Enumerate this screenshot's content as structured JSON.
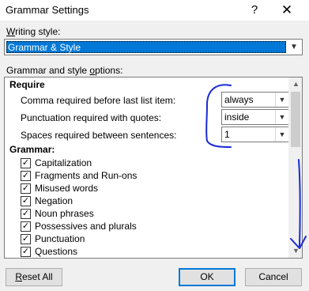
{
  "window": {
    "title": "Grammar Settings",
    "help_glyph": "?",
    "close_glyph": "✕"
  },
  "writing_style": {
    "label_hot": "W",
    "label_rest": "riting style:",
    "selected": "Grammar & Style"
  },
  "options": {
    "label_pre": "Grammar and style ",
    "label_hot": "o",
    "label_rest": "ptions:",
    "require_heading": "Require",
    "require_items": [
      {
        "label": "Comma required before last list item:",
        "value": "always"
      },
      {
        "label": "Punctuation required with quotes:",
        "value": "inside"
      },
      {
        "label": "Spaces required between sentences:",
        "value": "1"
      }
    ],
    "grammar_heading": "Grammar:",
    "grammar_items": [
      {
        "label": "Capitalization",
        "checked": true
      },
      {
        "label": "Fragments and Run-ons",
        "checked": true
      },
      {
        "label": "Misused words",
        "checked": true
      },
      {
        "label": "Negation",
        "checked": true
      },
      {
        "label": "Noun phrases",
        "checked": true
      },
      {
        "label": "Possessives and plurals",
        "checked": true
      },
      {
        "label": "Punctuation",
        "checked": true
      },
      {
        "label": "Questions",
        "checked": true
      }
    ]
  },
  "buttons": {
    "reset_hot": "R",
    "reset_rest": "eset All",
    "ok": "OK",
    "cancel": "Cancel"
  },
  "colors": {
    "selection_bg": "#0078d7",
    "annotation_ink": "#1a2bd6"
  }
}
